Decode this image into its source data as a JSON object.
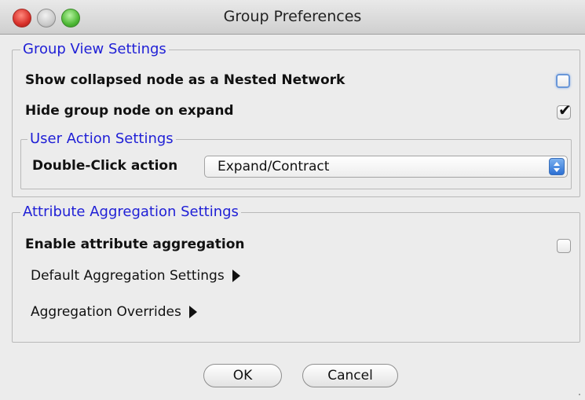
{
  "window": {
    "title": "Group Preferences"
  },
  "group_view": {
    "legend": "Group View Settings",
    "show_collapsed_label": "Show collapsed node as a Nested Network",
    "show_collapsed_checked": false,
    "hide_group_label": "Hide group node on expand",
    "hide_group_checked": true,
    "check_glyph": "✔",
    "user_action": {
      "legend": "User Action Settings",
      "double_click_label": "Double-Click action",
      "double_click_value": "Expand/Contract"
    }
  },
  "aggregation": {
    "legend": "Attribute Aggregation Settings",
    "enable_label": "Enable attribute aggregation",
    "enable_checked": false,
    "default_settings_label": "Default Aggregation Settings",
    "overrides_label": "Aggregation Overrides"
  },
  "buttons": {
    "ok_label": "OK",
    "cancel_label": "Cancel"
  },
  "colors": {
    "legend_text": "#1f1fd6",
    "select_accent": "#2c6fd3"
  }
}
